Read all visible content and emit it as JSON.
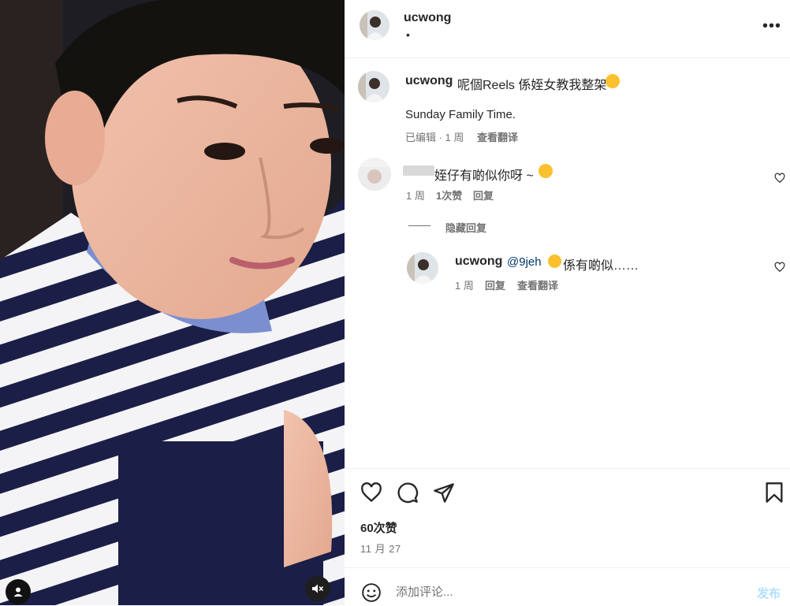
{
  "post": {
    "username": "ucwong",
    "header_sub": "•",
    "caption_text": "呢個Reels 係姪女教我整架",
    "caption_line2": "Sunday Family Time.",
    "caption_meta_edited": "已编辑 · 1 周",
    "caption_meta_translate": "查看翻译"
  },
  "comments": [
    {
      "text": "姪仔有啲似你呀 ~",
      "meta_time": "1 周",
      "meta_likes": "1次赞",
      "meta_reply": "回复"
    }
  ],
  "hide_replies": "隐藏回复",
  "reply": {
    "username": "ucwong",
    "mention": "@9jeh",
    "text": "係有啲似……",
    "meta_time": "1 周",
    "meta_reply": "回复",
    "meta_translate": "查看翻译"
  },
  "likes_label": "60次赞",
  "date_label": "11 月 27",
  "comment_box": {
    "placeholder": "添加评论...",
    "post_label": "发布"
  },
  "icons": {
    "more": "more-options-icon",
    "heart": "heart-icon",
    "comment": "comment-icon",
    "share": "share-icon",
    "bookmark": "bookmark-icon",
    "emoji": "emoji-icon",
    "mute": "muted-speaker-icon",
    "user_tag": "user-tag-icon"
  },
  "colors": {
    "link": "#00376b",
    "muted_text": "#737373",
    "post_disabled": "#b2dffc"
  }
}
